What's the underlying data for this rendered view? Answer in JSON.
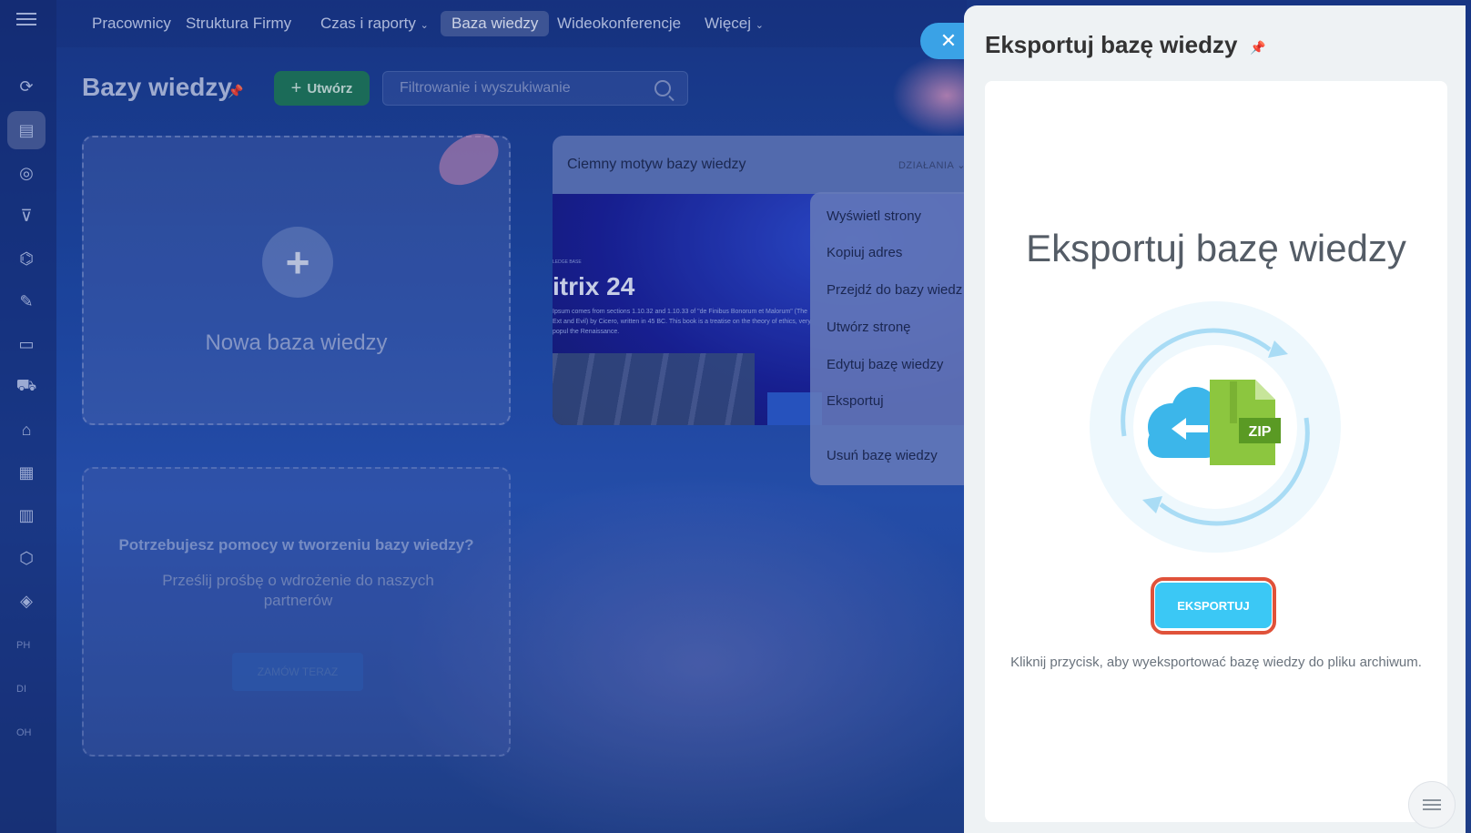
{
  "topnav": {
    "items": [
      {
        "label": "Pracownicy"
      },
      {
        "label": "Struktura Firmy"
      },
      {
        "label": "Czas i raporty",
        "chevron": true
      },
      {
        "label": "Baza wiedzy",
        "active": true
      },
      {
        "label": "Wideokonferencje"
      },
      {
        "label": "Więcej",
        "chevron": true
      }
    ]
  },
  "sidebar": {
    "icons": [
      "crm-icon",
      "knowledge-base-icon",
      "target-icon",
      "funnel-icon",
      "robot-icon",
      "edit-icon",
      "document-icon",
      "cart-icon",
      "warehouse-icon",
      "calendar-icon",
      "chart-icon",
      "settings-icon",
      "package-icon"
    ],
    "small_labels": [
      "PH",
      "DI",
      "OH"
    ]
  },
  "page": {
    "title": "Bazy wiedzy",
    "create_label": "Utwórz",
    "search_placeholder": "Filtrowanie i wyszukiwanie"
  },
  "new_card": {
    "label": "Nowa baza wiedzy"
  },
  "help_card": {
    "heading": "Potrzebujesz pomocy w tworzeniu bazy wiedzy?",
    "subtitle": "Prześlij prośbę o wdrożenie do naszych partnerów",
    "button": "ZAMÓW TERAZ"
  },
  "kb_card": {
    "title": "Ciemny motyw bazy wiedzy",
    "actions_label": "DZIAŁANIA",
    "preview_brand": "itrix 24",
    "preview_kicker": "LEDGE BASE",
    "preview_text": "Ipsum comes from sections 1.10.32 and 1.10.33 of \"de Finibus Bonorum et Malorum\" (The Ext and Evil) by Cicero, written in 45 BC. This book is a treatise on the theory of ethics, very popul the Renaissance."
  },
  "menu": {
    "items": [
      "Wyświetl strony",
      "Kopiuj adres",
      "Przejdź do bazy wiedz",
      "Utwórz stronę",
      "Edytuj bazę wiedzy",
      "Eksportuj",
      "Usuń bazę wiedzy"
    ]
  },
  "panel": {
    "title": "Eksportuj bazę wiedzy",
    "heading": "Eksportuj bazę wiedzy",
    "zip_label": "ZIP",
    "export_button": "EKSPORTUJ",
    "hint": "Kliknij przycisk, aby wyeksportować bazę wiedzy do pliku archiwum."
  },
  "colors": {
    "accent": "#3bc8f5",
    "highlight_ring": "#e0523a",
    "zip_green": "#8cc63f"
  }
}
